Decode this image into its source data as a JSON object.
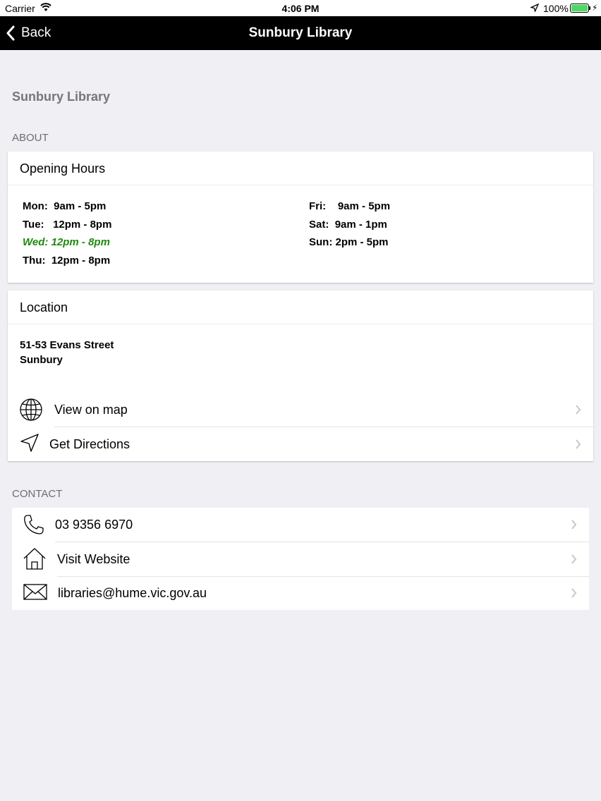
{
  "status_bar": {
    "carrier": "Carrier",
    "time": "4:06 PM",
    "battery": "100%"
  },
  "nav": {
    "back_label": "Back",
    "title": "Sunbury Library"
  },
  "page_heading": "Sunbury Library",
  "about": {
    "section_label": "ABOUT",
    "opening_hours": {
      "title": "Opening Hours",
      "left": [
        {
          "day": "Mon:",
          "hours": "9am - 5pm"
        },
        {
          "day": "Tue:",
          "hours": "12pm - 8pm"
        },
        {
          "day": "Wed:",
          "hours": "12pm - 8pm"
        },
        {
          "day": "Thu:",
          "hours": "12pm - 8pm"
        }
      ],
      "right": [
        {
          "day": "Fri:",
          "hours": "9am - 5pm"
        },
        {
          "day": "Sat:",
          "hours": "9am - 1pm"
        },
        {
          "day": "Sun:",
          "hours": "2pm - 5pm"
        }
      ],
      "today_highlight_color": "#1e8a0e"
    },
    "location": {
      "title": "Location",
      "address_line1": "51-53 Evans Street",
      "address_line2": "Sunbury",
      "view_on_map": "View on map",
      "get_directions": "Get Directions"
    }
  },
  "contact": {
    "section_label": "CONTACT",
    "phone": "03 9356 6970",
    "website": "Visit Website",
    "email": "libraries@hume.vic.gov.au"
  }
}
